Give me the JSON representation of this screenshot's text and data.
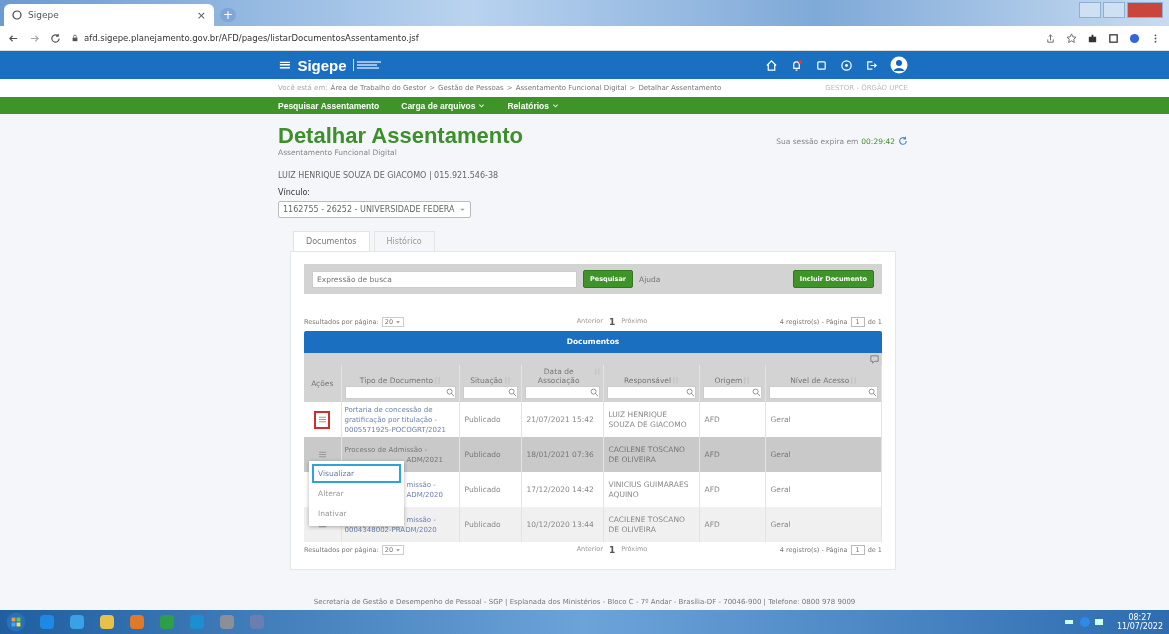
{
  "browser": {
    "tab_title": "Sigepe",
    "tab_close": "×",
    "new_tab": "+",
    "url": "afd.sigepe.planejamento.gov.br/AFD/pages/listarDocumentosAssentamento.jsf"
  },
  "header": {
    "menu_glyph": "≡",
    "brand": "Sigepe",
    "notification_dot": true
  },
  "breadcrumb": {
    "prefix": "Você está em:",
    "items": [
      {
        "text": "Área de Trabalho do Gestor",
        "sep": ">"
      },
      {
        "text": "Gestão de Pessoas",
        "sep": ">"
      },
      {
        "text": "Assentamento Funcional Digital",
        "sep": ">"
      },
      {
        "text": "Detalhar Assentamento"
      }
    ],
    "profile": "GESTOR - ÓRGÃO UPCE"
  },
  "nav": [
    {
      "label": "Pesquisar Assentamento",
      "dropdown": false
    },
    {
      "label": "Carga de arquivos",
      "dropdown": true
    },
    {
      "label": "Relatórios",
      "dropdown": true
    }
  ],
  "page": {
    "title": "Detalhar Assentamento",
    "subtitle": "Assentamento Funcional Digital",
    "person": "LUIZ HENRIQUE SOUZA DE GIACOMO | 015.921.546-38",
    "vinculo_label": "Vínculo:",
    "vinculo_value": "1162755 - 26252 - UNIVERSIDADE FEDERA",
    "session_label": "Sua sessão expira em",
    "session_time": "00:29:42"
  },
  "tabs": [
    {
      "label": "Documentos",
      "selected": true
    },
    {
      "label": "Histórico",
      "selected": false
    }
  ],
  "search": {
    "placeholder": "Expressão de busca",
    "button": "Pesquisar",
    "help": "Ajuda",
    "add_button": "Incluir Documento"
  },
  "pager_top": {
    "label": "Resultados por página:",
    "per_page": "20",
    "prev": "Anterior",
    "page": "1",
    "next": "Próximo",
    "records": "4 registro(s) - Página",
    "page_input": "1",
    "of": "de 1"
  },
  "table": {
    "title": "Documentos",
    "columns": [
      {
        "label": "Ações",
        "filter": false,
        "sort": false
      },
      {
        "label": "Tipo de Documento",
        "filter": true,
        "sort": true
      },
      {
        "label": "Situação",
        "filter": true,
        "sort": true
      },
      {
        "label": "Data de Associação",
        "filter": true,
        "sort": true
      },
      {
        "label": "Responsável",
        "filter": true,
        "sort": true
      },
      {
        "label": "Origem",
        "filter": true,
        "sort": true
      },
      {
        "label": "Nível de Acesso",
        "filter": true,
        "sort": true
      }
    ],
    "rows": [
      {
        "action_icon": true,
        "focused": true,
        "highlighted": false,
        "doc": [
          {
            "text": "Portaria de concessão de",
            "covered": false
          },
          {
            "text": "gratificação por titulação -",
            "covered": false
          },
          {
            "text": "0005571925-POCOGRT/2021",
            "covered": false
          }
        ],
        "status": "Publicado",
        "date": "21/07/2021 15:42",
        "responsible": "LUIZ HENRIQUE SOUZA DE GIACOMO",
        "origin": "AFD",
        "access": "Geral"
      },
      {
        "action_icon": true,
        "focused": false,
        "highlighted": true,
        "doc": [
          {
            "text": "Processo de Admissão -",
            "covered": false
          },
          {
            "text": "ADM/2021",
            "covered": true
          }
        ],
        "status": "Publicado",
        "date": "18/01/2021 07:36",
        "responsible": "CACILENE TOSCANO DE OLIVEIRA",
        "origin": "AFD",
        "access": "Geral"
      },
      {
        "highlighted": false,
        "doc": [
          {
            "text": "missão -",
            "covered": true
          },
          {
            "text": "ADM/2020",
            "covered": true
          }
        ],
        "status": "Publicado",
        "date": "17/12/2020 14:42",
        "responsible": "VINICIUS GUIMARAES AQUINO",
        "origin": "AFD",
        "access": "Geral"
      },
      {
        "action_icon": true,
        "focused": false,
        "highlighted": false,
        "doc": [
          {
            "text": "missão -",
            "covered": true
          },
          {
            "text": "0004348002-PRADM/2020",
            "covered": false
          }
        ],
        "status": "Publicado",
        "date": "10/12/2020 13:44",
        "responsible": "CACILENE TOSCANO DE OLIVEIRA",
        "origin": "AFD",
        "access": "Geral"
      }
    ],
    "action_menu": [
      {
        "label": "Visualizar",
        "selected": true
      },
      {
        "label": "Alterar",
        "selected": false
      },
      {
        "label": "Inativar",
        "selected": false
      }
    ]
  },
  "pager_bottom": {
    "label": "Resultados por página:",
    "per_page": "20",
    "prev": "Anterior",
    "page": "1",
    "next": "Próximo",
    "records": "4 registro(s) - Página",
    "page_input": "1",
    "of": "de 1"
  },
  "footer": "Secretaria de Gestão e Desempenho de Pessoal - SGP | Esplanada dos Ministérios - Bloco C - 7º Andar - Brasília-DF - 70046-900 | Telefone: 0800 978 9009",
  "taskbar": {
    "time": "08:27",
    "date": "11/07/2022"
  }
}
